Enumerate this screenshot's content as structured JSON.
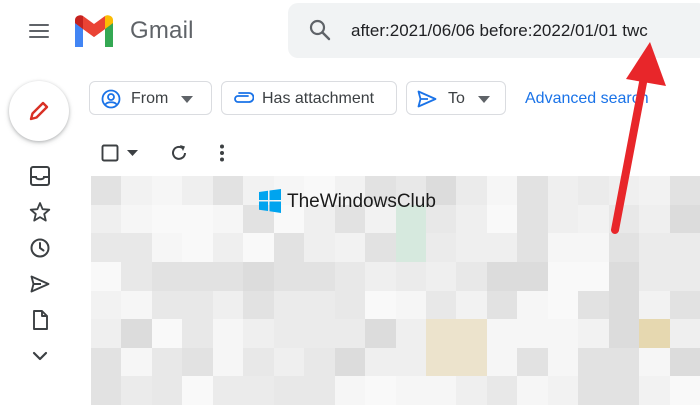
{
  "app": {
    "name": "Gmail",
    "menu_icon": "hamburger-menu-icon",
    "logo_icon": "gmail-logo-icon"
  },
  "search": {
    "icon": "search-icon",
    "value": "after:2021/06/06 before:2022/01/01 twc"
  },
  "filters": [
    {
      "label": "From",
      "icon": "person-circle-icon",
      "has_dropdown": true
    },
    {
      "label": "Has attachment",
      "icon": "paperclip-icon",
      "has_dropdown": false
    },
    {
      "label": "To",
      "icon": "send-icon",
      "has_dropdown": true
    }
  ],
  "advanced_search_label": "Advanced search",
  "compose": {
    "icon": "pencil-icon"
  },
  "nav_icons": [
    "inbox-icon",
    "star-icon",
    "clock-icon",
    "send-icon",
    "document-icon",
    "chevron-down-icon"
  ],
  "toolbar_icons": [
    "checkbox-icon",
    "caret-down-icon",
    "refresh-icon",
    "more-vert-icon"
  ],
  "watermark": {
    "text": "TheWindowsClub",
    "icon": "windows-logo-icon"
  },
  "annotation": {
    "icon": "red-arrow-icon",
    "color": "#e8262a"
  },
  "colors": {
    "accent": "#1a73e8",
    "compose_pencil": "#d93025",
    "search_bg": "#f1f3f4",
    "icon_gray": "#5f6368"
  }
}
